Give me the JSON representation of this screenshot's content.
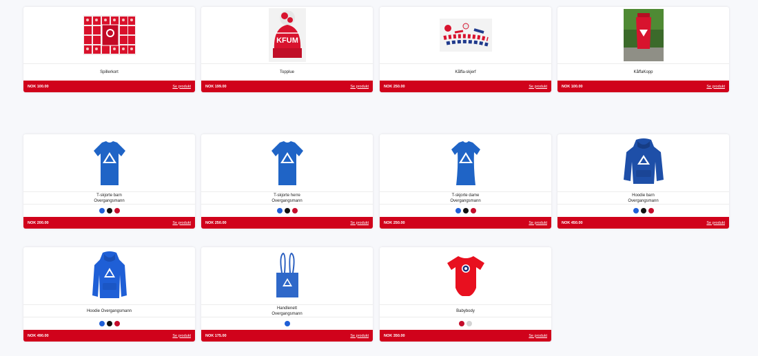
{
  "colors": {
    "accent": "#d0021b",
    "royal": "#1f5fd6",
    "black": "#111111",
    "red": "#c40c2a",
    "grey": "#d3d3d3"
  },
  "products": [
    {
      "name": "Spillerkort",
      "price": "NOK 100.00",
      "link": "Se produkt",
      "icon": "player-cards-image",
      "swatches": []
    },
    {
      "name": "Topplue",
      "price": "NOK 199.00",
      "link": "Se produkt",
      "icon": "beanie-image",
      "swatches": []
    },
    {
      "name": "Kåffa-skjerf",
      "price": "NOK 250.00",
      "link": "Se produkt",
      "icon": "scarf-image",
      "swatches": []
    },
    {
      "name": "KåffaKopp",
      "price": "NOK 100.00",
      "link": "Se produkt",
      "icon": "cup-image",
      "swatches": []
    },
    {
      "name": "T-skjorte barn\nOvergangsmann",
      "price": "NOK 200.00",
      "link": "Se produkt",
      "icon": "tshirt-image",
      "swatches": [
        "#1f5fd6",
        "#111111",
        "#c40c2a"
      ]
    },
    {
      "name": "T-skjorte herre\nOvergangsmann",
      "price": "NOK 250.00",
      "link": "Se produkt",
      "icon": "tshirt-image",
      "swatches": [
        "#1f5fd6",
        "#111111",
        "#c40c2a"
      ]
    },
    {
      "name": "T-skjorte dame\nOvergangsmann",
      "price": "NOK 250.00",
      "link": "Se produkt",
      "icon": "tshirt-image",
      "swatches": [
        "#1f5fd6",
        "#111111",
        "#c40c2a"
      ]
    },
    {
      "name": "Hoodie barn\nOvergangsmann",
      "price": "NOK 450.00",
      "link": "Se produkt",
      "icon": "hoodie-image",
      "swatches": [
        "#1f5fd6",
        "#111111",
        "#c40c2a"
      ]
    },
    {
      "name": "Hoodie Overgangsmann",
      "price": "NOK 490.00",
      "link": "Se produkt",
      "icon": "hoodie-image",
      "swatches": [
        "#1f5fd6",
        "#111111",
        "#c40c2a"
      ]
    },
    {
      "name": "Handlenett\nOvergangsmann",
      "price": "NOK 175.00",
      "link": "Se produkt",
      "icon": "tote-bag-image",
      "swatches": [
        "#1f5fd6"
      ]
    },
    {
      "name": "Babybody",
      "price": "NOK 350.00",
      "link": "Se produkt",
      "icon": "babybody-image",
      "swatches": [
        "#c40c2a",
        "#d3d3d3"
      ]
    }
  ]
}
